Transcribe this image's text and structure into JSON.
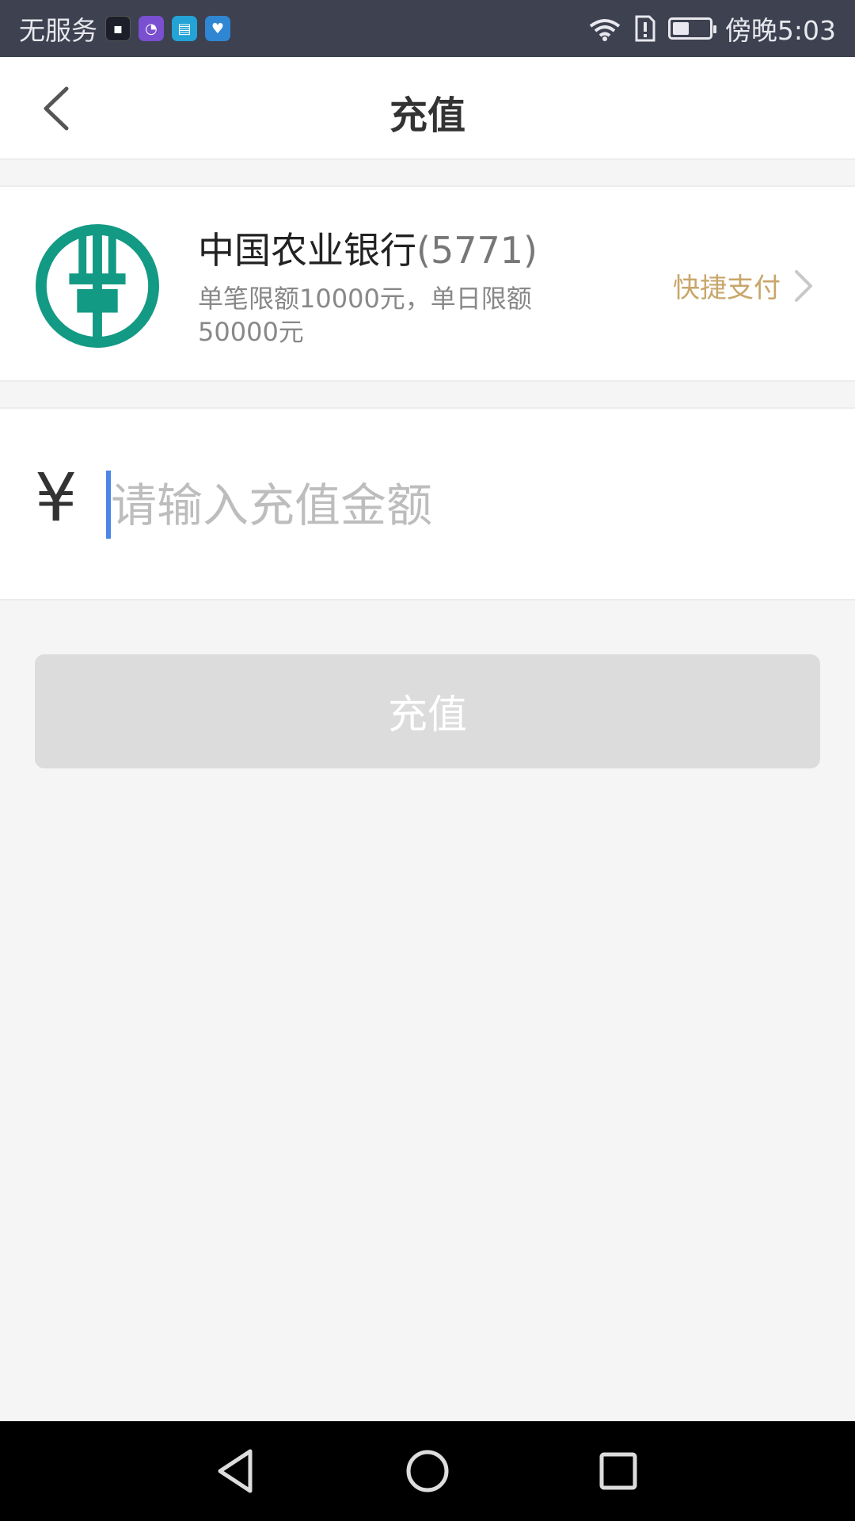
{
  "status_bar": {
    "carrier": "无服务",
    "time": "傍晚5:03",
    "battery_level": 0.45,
    "icons": [
      "huawei-app-icon",
      "pie-app-icon",
      "book-app-icon",
      "heart-app-icon",
      "wifi-icon",
      "sim-alert-icon",
      "battery-icon"
    ]
  },
  "nav": {
    "title": "充值",
    "back_icon": "chevron-left-icon"
  },
  "bank": {
    "name": "中国农业银行",
    "card_suffix": "(5771)",
    "limit_text": "单笔限额10000元，单日限额50000元",
    "pay_method": "快捷支付",
    "logo_color": "#139a84"
  },
  "amount": {
    "currency_symbol": "¥",
    "placeholder": "请输入充值金额",
    "value": ""
  },
  "action": {
    "recharge_label": "充值",
    "button_color": "#dcdcdc"
  },
  "system_nav": {
    "buttons": [
      "back-triangle-icon",
      "home-circle-icon",
      "recents-square-icon"
    ]
  }
}
